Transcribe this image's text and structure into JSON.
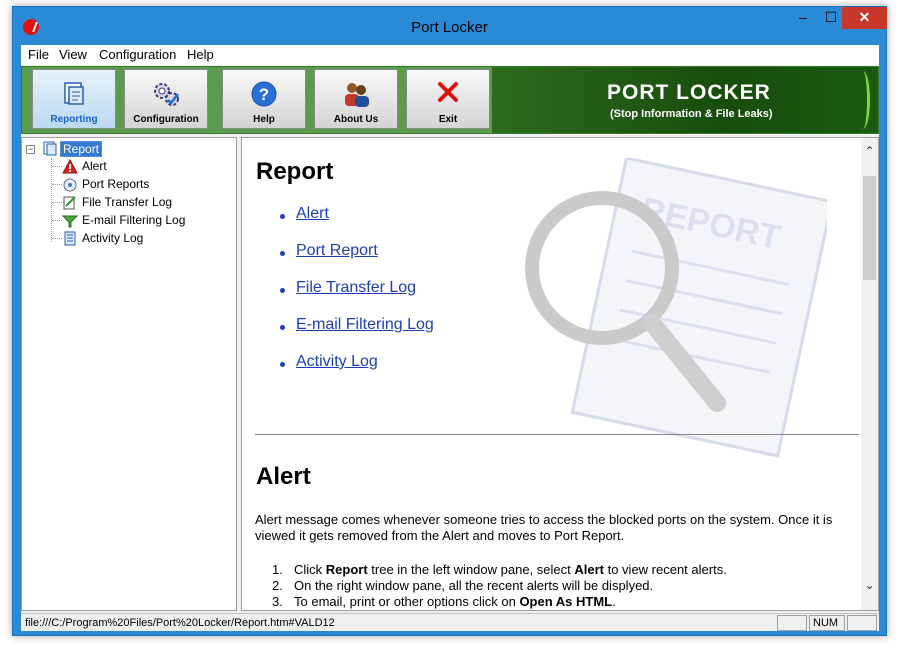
{
  "window": {
    "title": "Port Locker",
    "min": "–",
    "max": "☐",
    "close": "✕"
  },
  "menu": [
    "File",
    "View",
    "Configuration",
    "Help"
  ],
  "toolbar": {
    "buttons": [
      "Reporting",
      "Configuration",
      "Help",
      "About Us",
      "Exit"
    ],
    "active": "Reporting",
    "banner_title": "PORT LOCKER",
    "banner_subtitle": "(Stop Information & File Leaks)"
  },
  "tree": {
    "expander": "−",
    "root": "Report",
    "children": [
      "Alert",
      "Port Reports",
      "File Transfer Log",
      "E-mail Filtering Log",
      "Activity Log"
    ]
  },
  "content": {
    "heading": "Report",
    "links": [
      "Alert",
      "Port Report",
      "File Transfer Log",
      "E-mail Filtering Log",
      "Activity Log"
    ],
    "section_heading": "Alert",
    "paragraph": "Alert message comes whenever someone tries to access the blocked ports on the system. Once it is viewed it gets removed from the Alert and moves to Port Report.",
    "steps": [
      {
        "num": "1.",
        "a": "Click ",
        "b1": "Report",
        "c": " tree in the left window pane, select ",
        "b2": "Alert",
        "d": " to view recent alerts."
      },
      {
        "num": "2.",
        "a": "On the right window pane, all the recent alerts will be displyed.",
        "b1": "",
        "c": "",
        "b2": "",
        "d": ""
      },
      {
        "num": "3.",
        "a": "To email, print or other options click on ",
        "b1": "Open As HTML",
        "c": ".",
        "b2": "",
        "d": ""
      }
    ],
    "watermark_text": "REPORT"
  },
  "scroll": {
    "up": "⌃",
    "down": "⌄"
  },
  "status": {
    "url": "file:///C:/Program%20Files/Port%20Locker/Report.htm#VALD12",
    "pane1": "",
    "num": "NUM",
    "pane3": ""
  },
  "colors": {
    "banner": "#1a4d10",
    "link": "#1c3fb4",
    "close": "#c7382a",
    "tree_select": "#3579d3"
  }
}
